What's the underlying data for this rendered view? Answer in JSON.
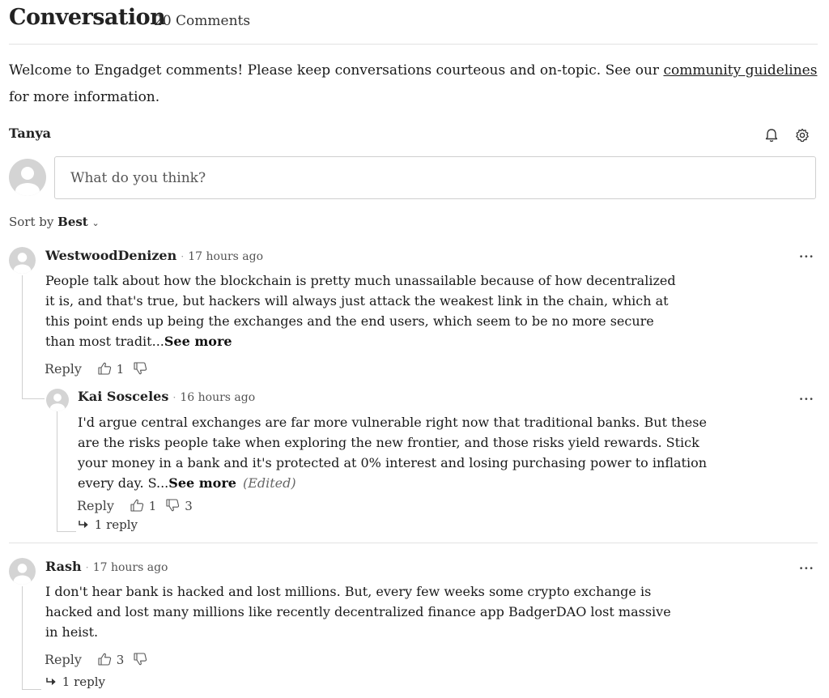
{
  "header": {
    "title": "Conversation",
    "count": "20 Comments"
  },
  "welcome": {
    "text_before": "Welcome to Engadget comments! Please keep conversations courteous and on-topic. See our ",
    "link": "community guidelines",
    "text_after": "for more information."
  },
  "user": {
    "name": "Tanya"
  },
  "compose": {
    "placeholder": "What do you think?"
  },
  "sort": {
    "prefix": "Sort by",
    "value": "Best"
  },
  "comments": [
    {
      "author": "WestwoodDenizen",
      "time": "17 hours ago",
      "text": "People talk about how the blockchain is pretty much unassailable because of how decentralized it is, and that's true, but hackers will always just attack the weakest link in the chain, which at this point ends up being the exchanges and the end users, which seem to be no more secure than most tradit...",
      "see_more": "See more",
      "reply": "Reply",
      "likes": "1",
      "dislikes": "",
      "replies": [
        {
          "author": "Kai Sosceles",
          "time": "16 hours ago",
          "text": "I'd argue central exchanges are far more vulnerable right now that traditional banks. But these are the risks people take when exploring the new frontier, and those risks yield rewards. Stick your money in a bank and it's protected at 0% interest and losing purchasing power to inflation every day. S...",
          "see_more": "See more",
          "edited": "(Edited)",
          "reply": "Reply",
          "likes": "1",
          "dislikes": "3",
          "replies_count": "1 reply"
        }
      ]
    },
    {
      "author": "Rash",
      "time": "17 hours ago",
      "text": "I don't hear bank is hacked and lost millions. But, every few weeks some crypto exchange is hacked and lost many millions like recently decentralized finance app BadgerDAO lost massive in heist.",
      "reply": "Reply",
      "likes": "3",
      "dislikes": "",
      "replies_count": "1 reply"
    }
  ],
  "icons": [
    "bell-icon",
    "gear-icon",
    "avatar-icon",
    "thumbs-up-icon",
    "thumbs-down-icon",
    "reply-arrow-icon",
    "more-icon",
    "chevron-down-icon"
  ]
}
